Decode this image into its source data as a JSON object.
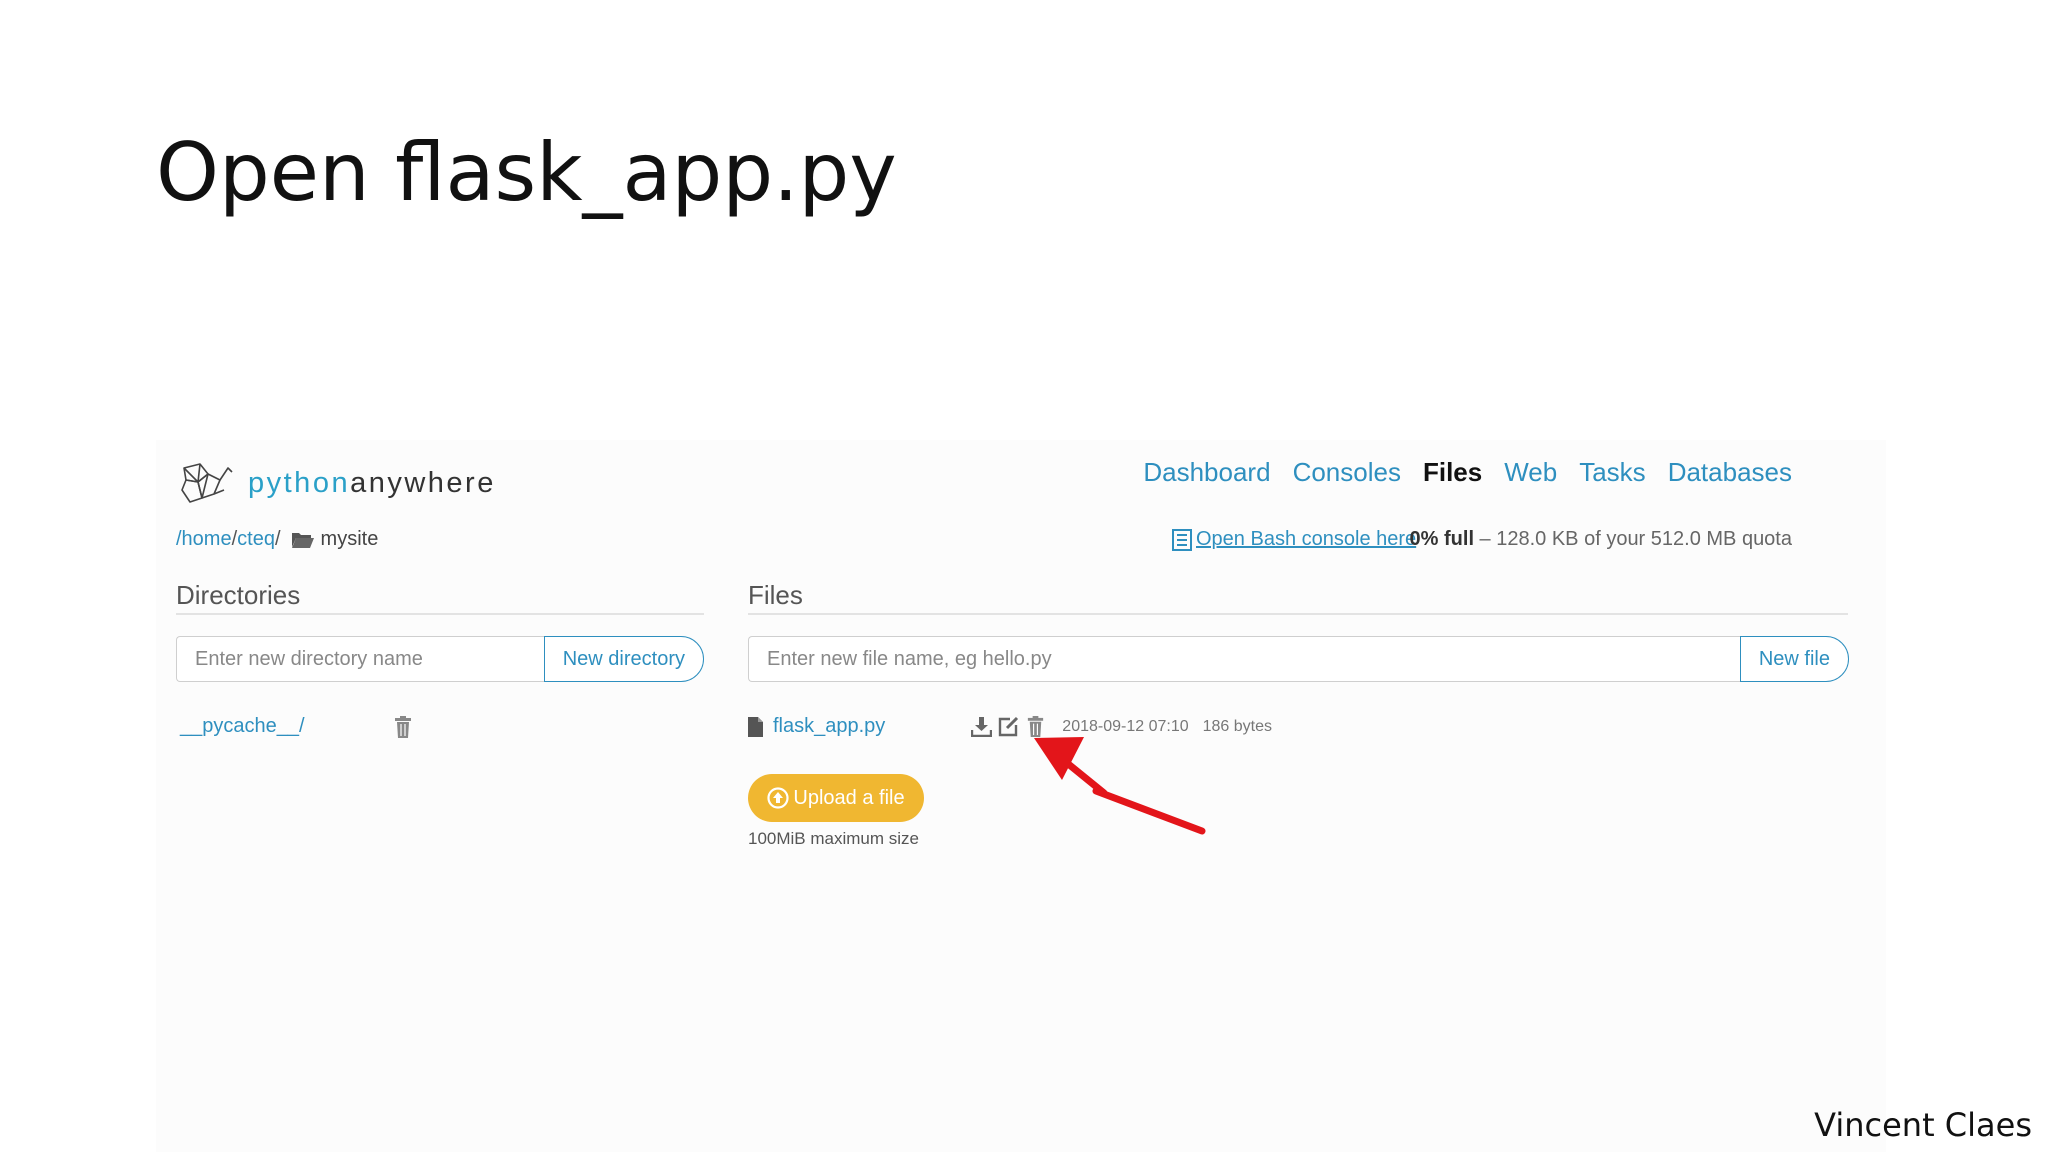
{
  "slide": {
    "title": "Open flask_app.py",
    "author": "Vincent Claes"
  },
  "app": {
    "brand_python": "python",
    "brand_anywhere": "anywhere",
    "nav": [
      "Dashboard",
      "Consoles",
      "Files",
      "Web",
      "Tasks",
      "Databases"
    ],
    "nav_active": "Files"
  },
  "breadcrumb": {
    "home": "/home",
    "sep1": "/",
    "user": "cteq",
    "sep2": "/",
    "current": "mysite"
  },
  "toolbar": {
    "bash_link": "Open Bash console here",
    "quota_bold": "0% full",
    "quota_rest": " – 128.0 KB of your 512.0 MB quota"
  },
  "directories": {
    "heading": "Directories",
    "input_placeholder": "Enter new directory name",
    "button": "New directory",
    "items": [
      {
        "name": "__pycache__/"
      }
    ]
  },
  "files": {
    "heading": "Files",
    "input_placeholder": "Enter new file name, eg hello.py",
    "button": "New file",
    "items": [
      {
        "name": "flask_app.py",
        "modified": "2018-09-12 07:10",
        "size": "186 bytes"
      }
    ],
    "upload_button": "Upload a file",
    "upload_note": "100MiB maximum size"
  },
  "colors": {
    "link": "#2e8fbf",
    "upload_button": "#f0b731",
    "annotation_arrow": "#e3151a"
  }
}
